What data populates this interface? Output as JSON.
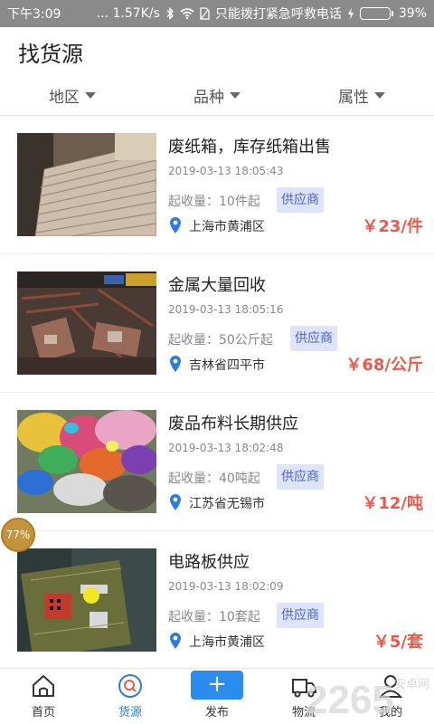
{
  "status_bar": {
    "time": "下午3:09",
    "network_speed": "... 1.57K/s",
    "carrier": "只能拨打紧急呼救电话",
    "battery_percent": "39%",
    "battery_level": 0.39
  },
  "header": {
    "title": "找货源"
  },
  "filters": [
    {
      "label": "地区"
    },
    {
      "label": "品种"
    },
    {
      "label": "属性"
    }
  ],
  "listings": [
    {
      "title": "废纸箱，库存纸箱出售",
      "date": "2019-03-13 18:05:43",
      "min_qty": "起收量：10件起",
      "tag": "供应商",
      "location": "上海市黄浦区",
      "price": "￥23/件",
      "image": "cardboard-stacks"
    },
    {
      "title": "金属大量回收",
      "date": "2019-03-13 18:05:16",
      "min_qty": "起收量：50公斤起",
      "tag": "供应商",
      "location": "吉林省四平市",
      "price": "￥68/公斤",
      "image": "scrap-metal"
    },
    {
      "title": "废品布料长期供应",
      "date": "2019-03-13 18:02:48",
      "min_qty": "起收量：40吨起",
      "tag": "供应商",
      "location": "江苏省无锡市",
      "price": "￥12/吨",
      "image": "fabric-scraps"
    },
    {
      "title": "电路板供应",
      "date": "2019-03-13 18:02:09",
      "min_qty": "起收量：10套起",
      "tag": "供应商",
      "location": "上海市黄浦区",
      "price": "￥5/套",
      "image": "circuit-board"
    }
  ],
  "overlay_badge": {
    "text": "77%",
    "value": 0.77
  },
  "tab_bar": {
    "tabs": [
      {
        "label": "首页",
        "icon": "home-icon"
      },
      {
        "label": "货源",
        "icon": "search-icon",
        "active": true
      },
      {
        "label": "发布",
        "icon": "plus-icon"
      },
      {
        "label": "物流",
        "icon": "truck-icon"
      },
      {
        "label": "我的",
        "icon": "user-icon"
      }
    ]
  },
  "watermark": {
    "text": "2265",
    "subtext": "安卓网"
  },
  "colors": {
    "accent": "#2b8cf0",
    "price": "#e95a4a",
    "tag_bg": "#dde4fb",
    "tag_text": "#4a63c9",
    "status_bar": "#8a8a8a"
  }
}
